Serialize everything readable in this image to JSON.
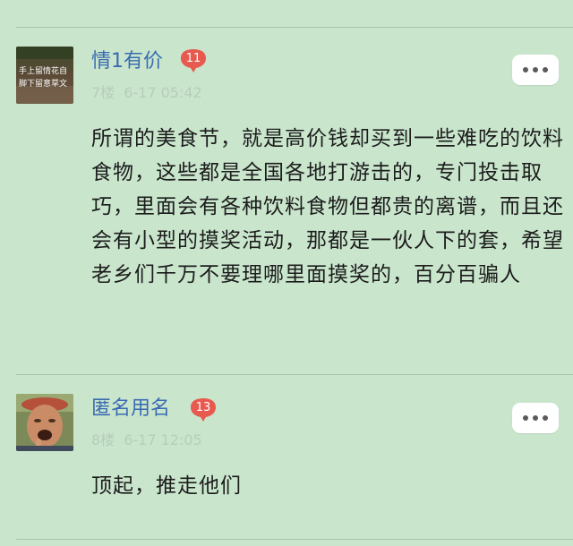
{
  "posts": [
    {
      "username": "情1有价",
      "badge": "11",
      "floor": "7楼",
      "time": "6-17 05:42",
      "avatar_text": [
        "手上留情花自",
        "脚下留意草文"
      ],
      "content": "所谓的美食节，就是高价钱却买到一些难吃的饮料食物，这些都是全国各地打游击的，专门投击取巧，里面会有各种饮料食物但都贵的离谱，而且还会有小型的摸奖活动，那都是一伙人下的套，希望老乡们千万不要理哪里面摸奖的，百分百骗人"
    },
    {
      "username": "匿名用名",
      "badge": "13",
      "floor": "8楼",
      "time": "6-17 12:05",
      "content": "顶起，推走他们"
    }
  ],
  "colors": {
    "background": "#c9e6cd",
    "username": "#3a6bb0",
    "badge": "#e85a4f",
    "meta": "#b7cdb9",
    "text": "#1c1c1c"
  },
  "icons": {
    "more": "more-dots-icon",
    "badge": "level-badge-icon"
  }
}
